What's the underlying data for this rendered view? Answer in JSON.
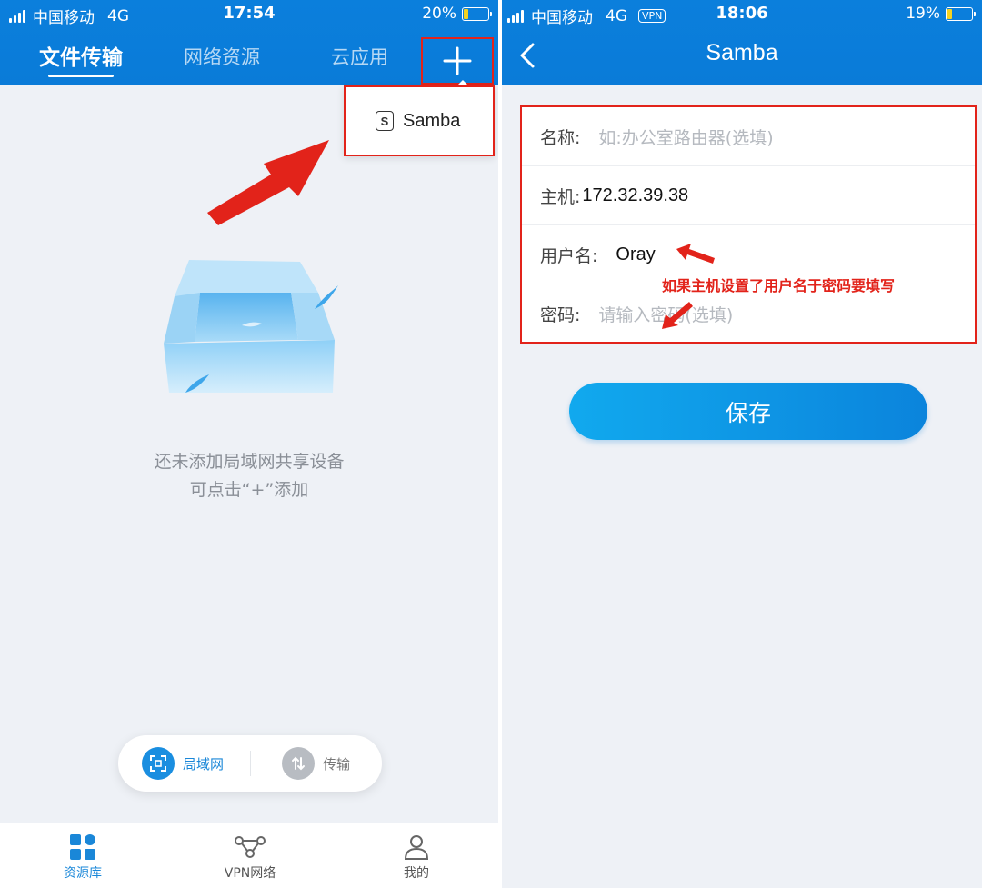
{
  "left": {
    "status": {
      "carrier": "中国移动",
      "network": "4G",
      "time": "17:54",
      "battery": "20%",
      "battery_level": 0.2
    },
    "tabs": [
      "文件传输",
      "网络资源",
      "云应用"
    ],
    "active_tab": "文件传输",
    "plus_icon": "plus-icon",
    "dropdown": {
      "icon": "samba-s-icon",
      "label": "Samba"
    },
    "empty_state": {
      "line1": "还未添加局域网共享设备",
      "line2": "可点击“+”添加"
    },
    "toggle": {
      "lan_label": "局域网",
      "lan_icon": "lan-scan-icon",
      "transfer_label": "传输",
      "transfer_icon": "transfer-arrows-icon"
    },
    "bottom_nav": [
      {
        "label": "资源库",
        "icon": "grid-icon",
        "active": true
      },
      {
        "label": "VPN网络",
        "icon": "network-nodes-icon",
        "active": false
      },
      {
        "label": "我的",
        "icon": "user-icon",
        "active": false
      }
    ]
  },
  "right": {
    "status": {
      "carrier": "中国移动",
      "network": "4G",
      "vpn_badge": "VPN",
      "time": "18:06",
      "battery": "19%",
      "battery_level": 0.19
    },
    "title": "Samba",
    "back_icon": "chevron-left-icon",
    "form": {
      "name_label": "名称:",
      "name_placeholder": "如:办公室路由器(选填)",
      "host_label": "主机:",
      "host_value": "172.32.39.38",
      "user_label": "用户名:",
      "user_value": "Oray",
      "password_label": "密码:",
      "password_placeholder": "请输入密码(选填)"
    },
    "annotation": "如果主机设置了用户名于密码要填写",
    "save_label": "保存"
  },
  "colors": {
    "header": "#0a7bd8",
    "accent": "#1a87d8",
    "highlight": "#e2231a",
    "background": "#eef1f6"
  }
}
